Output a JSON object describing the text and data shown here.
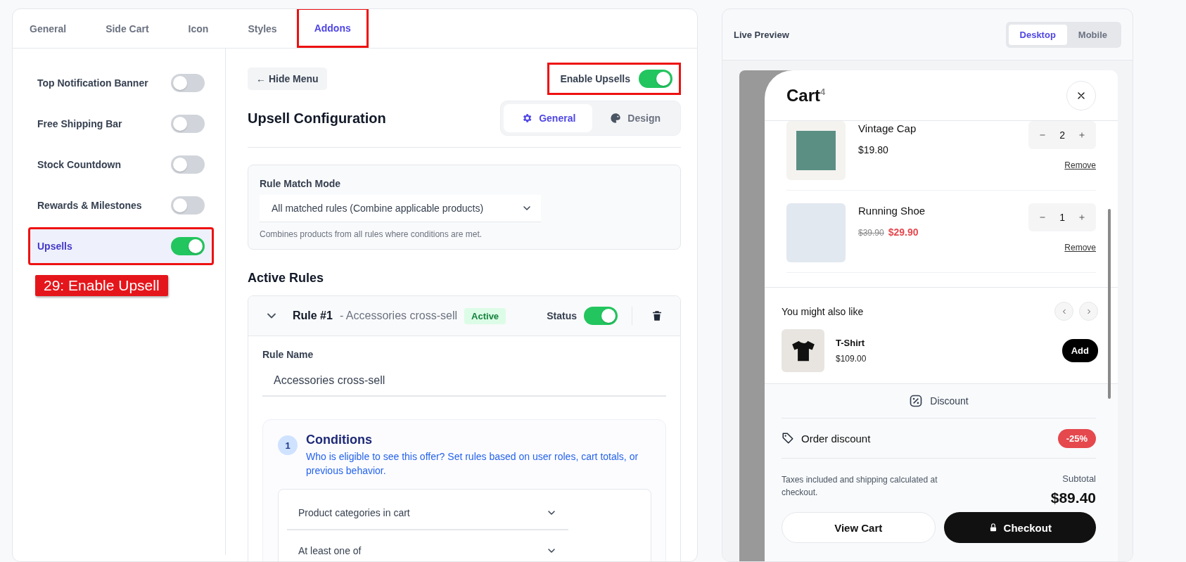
{
  "tabs": [
    {
      "label": "General",
      "selected": false,
      "highlighted": false
    },
    {
      "label": "Side Cart",
      "selected": false,
      "highlighted": false
    },
    {
      "label": "Icon",
      "selected": false,
      "highlighted": false
    },
    {
      "label": "Styles",
      "selected": false,
      "highlighted": false
    },
    {
      "label": "Addons",
      "selected": true,
      "highlighted": true
    }
  ],
  "sidebar": {
    "items": [
      {
        "label": "Top Notification Banner",
        "on": false,
        "selected": false,
        "highlighted": false
      },
      {
        "label": "Free Shipping Bar",
        "on": false,
        "selected": false,
        "highlighted": false
      },
      {
        "label": "Stock Countdown",
        "on": false,
        "selected": false,
        "highlighted": false
      },
      {
        "label": "Rewards & Milestones",
        "on": false,
        "selected": false,
        "highlighted": false
      },
      {
        "label": "Upsells",
        "on": true,
        "selected": true,
        "highlighted": true
      }
    ]
  },
  "annotation_label": "29: Enable Upsell",
  "hide_menu_button": "← Hide Menu",
  "enable_upsells": {
    "label": "Enable Upsells",
    "on": true,
    "highlighted": true
  },
  "config": {
    "title": "Upsell Configuration",
    "tabs": [
      {
        "label": "General",
        "kind": "gear",
        "selected": true
      },
      {
        "label": "Design",
        "kind": "palette",
        "selected": false
      }
    ]
  },
  "rule_match": {
    "label": "Rule Match Mode",
    "value": "All matched rules (Combine applicable products)",
    "help": "Combines products from all rules where conditions are met."
  },
  "active_rules": {
    "title": "Active Rules",
    "rules": [
      {
        "title": "Rule #1",
        "subtitle": "- Accessories cross-sell",
        "badge": "Active",
        "status_label": "Status",
        "on": true,
        "expanded": true,
        "name_label": "Rule Name",
        "name_value": "Accessories cross-sell",
        "conditions": {
          "number": "1",
          "title": "Conditions",
          "description": "Who is eligible to see this offer? Set rules based on user roles, cart totals, or previous behavior.",
          "selects": [
            "Product categories in cart",
            "At least one of"
          ]
        }
      }
    ]
  },
  "preview": {
    "title": "Live Preview",
    "modes": [
      {
        "label": "Desktop",
        "selected": true
      },
      {
        "label": "Mobile",
        "selected": false
      }
    ],
    "cart": {
      "title": "Cart",
      "count": "4",
      "items": [
        {
          "name": "Vintage Cap",
          "price": "$19.80",
          "quantity": "2",
          "remove": "Remove",
          "kind": "cap"
        },
        {
          "name": "Running Shoe",
          "original_price": "$39.90",
          "price": "$29.90",
          "quantity": "1",
          "remove": "Remove",
          "kind": "shoe"
        }
      ],
      "upsell": {
        "title": "You might also like",
        "products": [
          {
            "name": "T-Shirt",
            "price": "$109.00",
            "button": "Add"
          }
        ]
      },
      "discount": {
        "label": "Discount",
        "order_label": "Order discount",
        "badge": "-25%"
      },
      "note": "Taxes included and shipping calculated at checkout.",
      "subtotal_label": "Subtotal",
      "subtotal": "$89.40",
      "buttons": [
        {
          "label": "View Cart",
          "kind": "secondary"
        },
        {
          "label": "Checkout",
          "kind": "primary"
        }
      ]
    }
  }
}
